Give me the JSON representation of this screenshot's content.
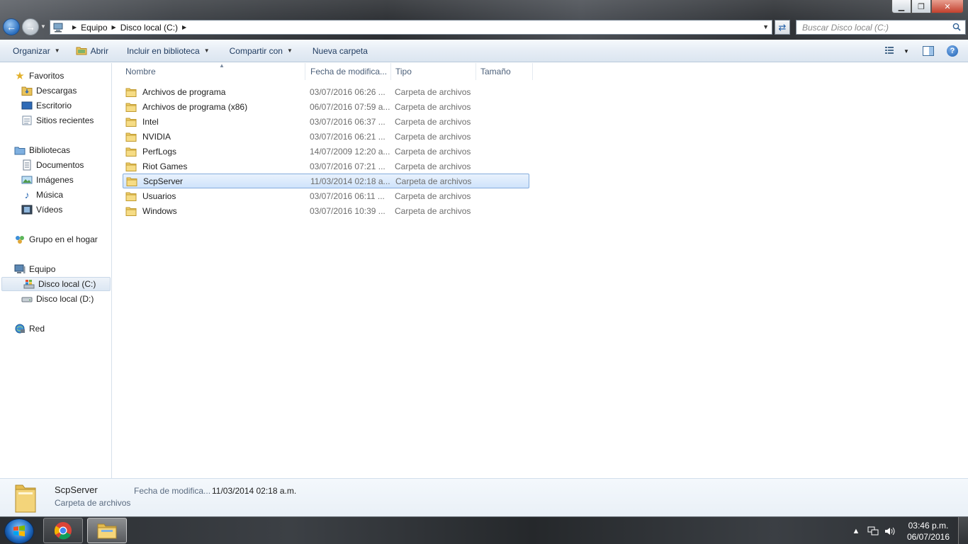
{
  "window": {
    "controls": {
      "minimize": "▁",
      "maximize": "❐",
      "close": "✕"
    }
  },
  "address": {
    "crumbs": [
      "Equipo",
      "Disco local (C:)"
    ]
  },
  "search": {
    "placeholder": "Buscar Disco local (C:)"
  },
  "toolbar": {
    "organize": "Organizar",
    "open": "Abrir",
    "include_library": "Incluir en biblioteca",
    "share_with": "Compartir con",
    "new_folder": "Nueva carpeta"
  },
  "navpane": {
    "favorites": {
      "label": "Favoritos",
      "items": [
        "Descargas",
        "Escritorio",
        "Sitios recientes"
      ]
    },
    "libraries": {
      "label": "Bibliotecas",
      "items": [
        "Documentos",
        "Imágenes",
        "Música",
        "Vídeos"
      ]
    },
    "homegroup": {
      "label": "Grupo en el hogar"
    },
    "computer": {
      "label": "Equipo",
      "items": [
        "Disco local (C:)",
        "Disco local (D:)"
      ]
    },
    "network": {
      "label": "Red"
    }
  },
  "columns": {
    "name": "Nombre",
    "date": "Fecha de modifica...",
    "type": "Tipo",
    "size": "Tamaño"
  },
  "files": [
    {
      "name": "Archivos de programa",
      "date": "03/07/2016 06:26 ...",
      "type": "Carpeta de archivos"
    },
    {
      "name": "Archivos de programa (x86)",
      "date": "06/07/2016 07:59 a...",
      "type": "Carpeta de archivos"
    },
    {
      "name": "Intel",
      "date": "03/07/2016 06:37 ...",
      "type": "Carpeta de archivos"
    },
    {
      "name": "NVIDIA",
      "date": "03/07/2016 06:21 ...",
      "type": "Carpeta de archivos"
    },
    {
      "name": "PerfLogs",
      "date": "14/07/2009 12:20 a...",
      "type": "Carpeta de archivos"
    },
    {
      "name": "Riot Games",
      "date": "03/07/2016 07:21 ...",
      "type": "Carpeta de archivos"
    },
    {
      "name": "ScpServer",
      "date": "11/03/2014 02:18 a...",
      "type": "Carpeta de archivos",
      "selected": true
    },
    {
      "name": "Usuarios",
      "date": "03/07/2016 06:11 ...",
      "type": "Carpeta de archivos"
    },
    {
      "name": "Windows",
      "date": "03/07/2016 10:39 ...",
      "type": "Carpeta de archivos"
    }
  ],
  "details": {
    "name": "ScpServer",
    "type": "Carpeta de archivos",
    "date_label": "Fecha de modifica...",
    "date_value": "11/03/2014 02:18 a.m."
  },
  "taskbar": {
    "clock_time": "03:46 p.m.",
    "clock_date": "06/07/2016",
    "tray_expand": "▲"
  },
  "icons": {
    "folder": "folder-icon",
    "star": "star-icon",
    "drive": "drive-icon",
    "help": "?"
  },
  "colors": {
    "selection": "#cfe3fb",
    "accent": "#1f5da8"
  }
}
